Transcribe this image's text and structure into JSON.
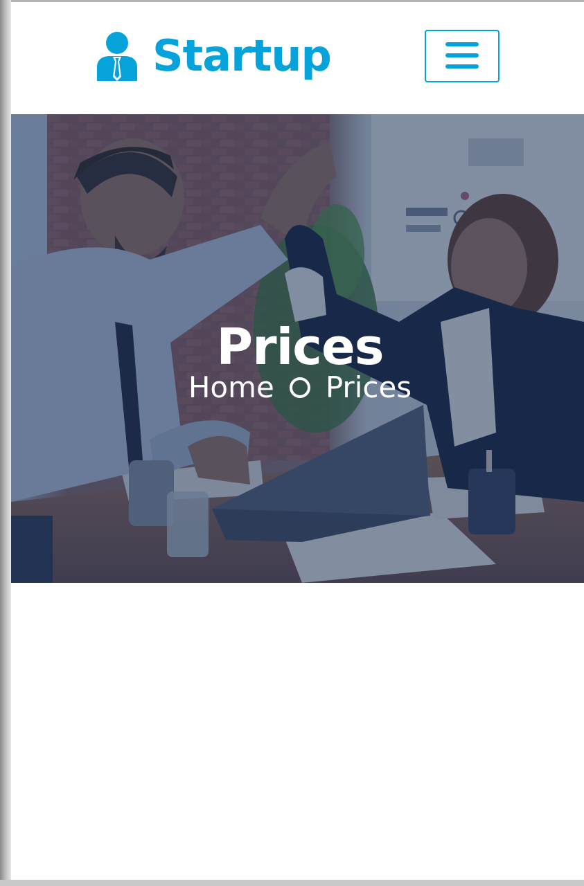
{
  "navbar": {
    "brand_name": "Startup",
    "brand_icon": "user-tie-icon",
    "menu_icon": "hamburger-menu-icon"
  },
  "hero": {
    "title": "Prices",
    "breadcrumb": {
      "home_label": "Home",
      "separator_icon": "circle-outline-icon",
      "current_label": "Prices"
    }
  },
  "colors": {
    "brand_primary": "#06a3da",
    "hero_overlay": "#091e3e",
    "text_light": "#ffffff"
  }
}
